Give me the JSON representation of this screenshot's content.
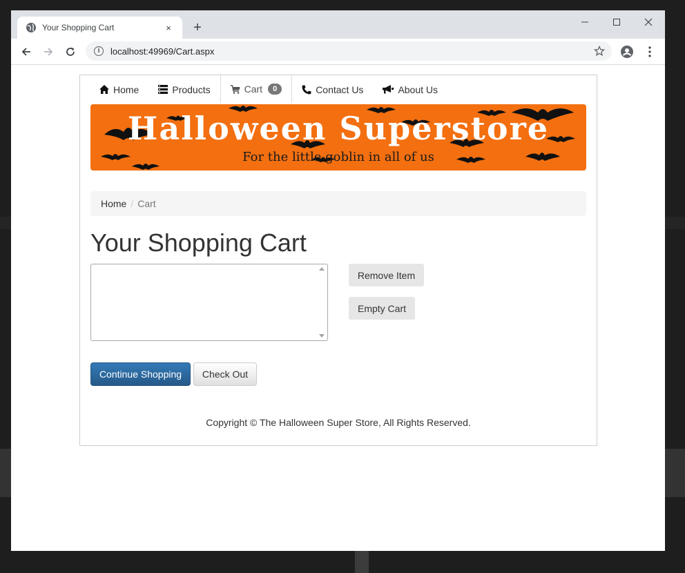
{
  "browser": {
    "tab_title": "Your Shopping Cart",
    "tab_close": "×",
    "new_tab": "+",
    "url": "localhost:49969/Cart.aspx"
  },
  "nav": {
    "items": [
      {
        "label": "Home",
        "icon": "home-icon"
      },
      {
        "label": "Products",
        "icon": "list-icon"
      },
      {
        "label": "Cart",
        "icon": "cart-icon",
        "badge": "0"
      },
      {
        "label": "Contact Us",
        "icon": "phone-icon"
      },
      {
        "label": "About Us",
        "icon": "bullhorn-icon"
      }
    ]
  },
  "banner": {
    "title": "Halloween Superstore",
    "subtitle": "For the little goblin in all of us"
  },
  "breadcrumb": {
    "home": "Home",
    "separator": "/",
    "current": "Cart"
  },
  "page": {
    "heading": "Your Shopping Cart",
    "remove_item": "Remove Item",
    "empty_cart": "Empty Cart",
    "continue_shopping": "Continue Shopping",
    "check_out": "Check Out",
    "footer": "Copyright © The Halloween Super Store, All Rights Reserved."
  },
  "colors": {
    "banner_orange": "#f36f10",
    "primary_blue": "#337ab7"
  }
}
